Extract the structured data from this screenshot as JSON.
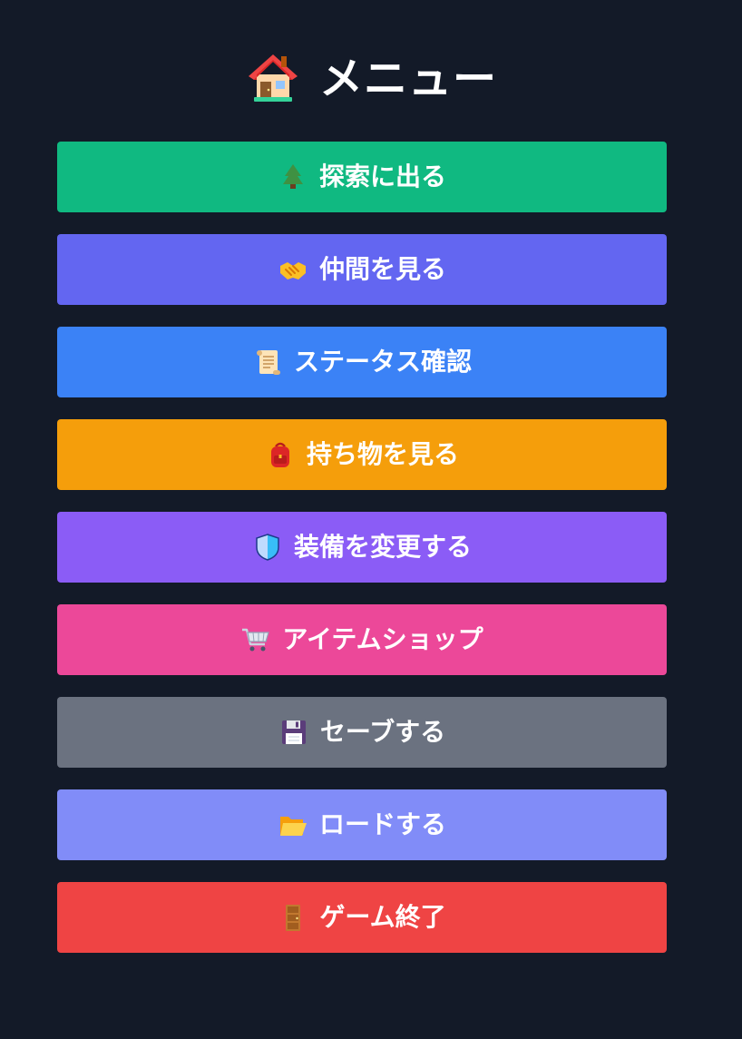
{
  "title": {
    "text": "メニュー",
    "icon": "house-icon"
  },
  "menu": {
    "buttons": [
      {
        "label": "探索に出る",
        "icon": "tree-icon",
        "color": "#10b981"
      },
      {
        "label": "仲間を見る",
        "icon": "handshake-icon",
        "color": "#6366f1"
      },
      {
        "label": "ステータス確認",
        "icon": "scroll-icon",
        "color": "#3b82f6"
      },
      {
        "label": "持ち物を見る",
        "icon": "backpack-icon",
        "color": "#f59e0b"
      },
      {
        "label": "装備を変更する",
        "icon": "shield-icon",
        "color": "#8b5cf6"
      },
      {
        "label": "アイテムショップ",
        "icon": "shopping-cart-icon",
        "color": "#ec4899"
      },
      {
        "label": "セーブする",
        "icon": "floppy-disk-icon",
        "color": "#6b7280"
      },
      {
        "label": "ロードする",
        "icon": "folder-open-icon",
        "color": "#818cf8"
      },
      {
        "label": "ゲーム終了",
        "icon": "door-icon",
        "color": "#ef4444"
      }
    ]
  }
}
